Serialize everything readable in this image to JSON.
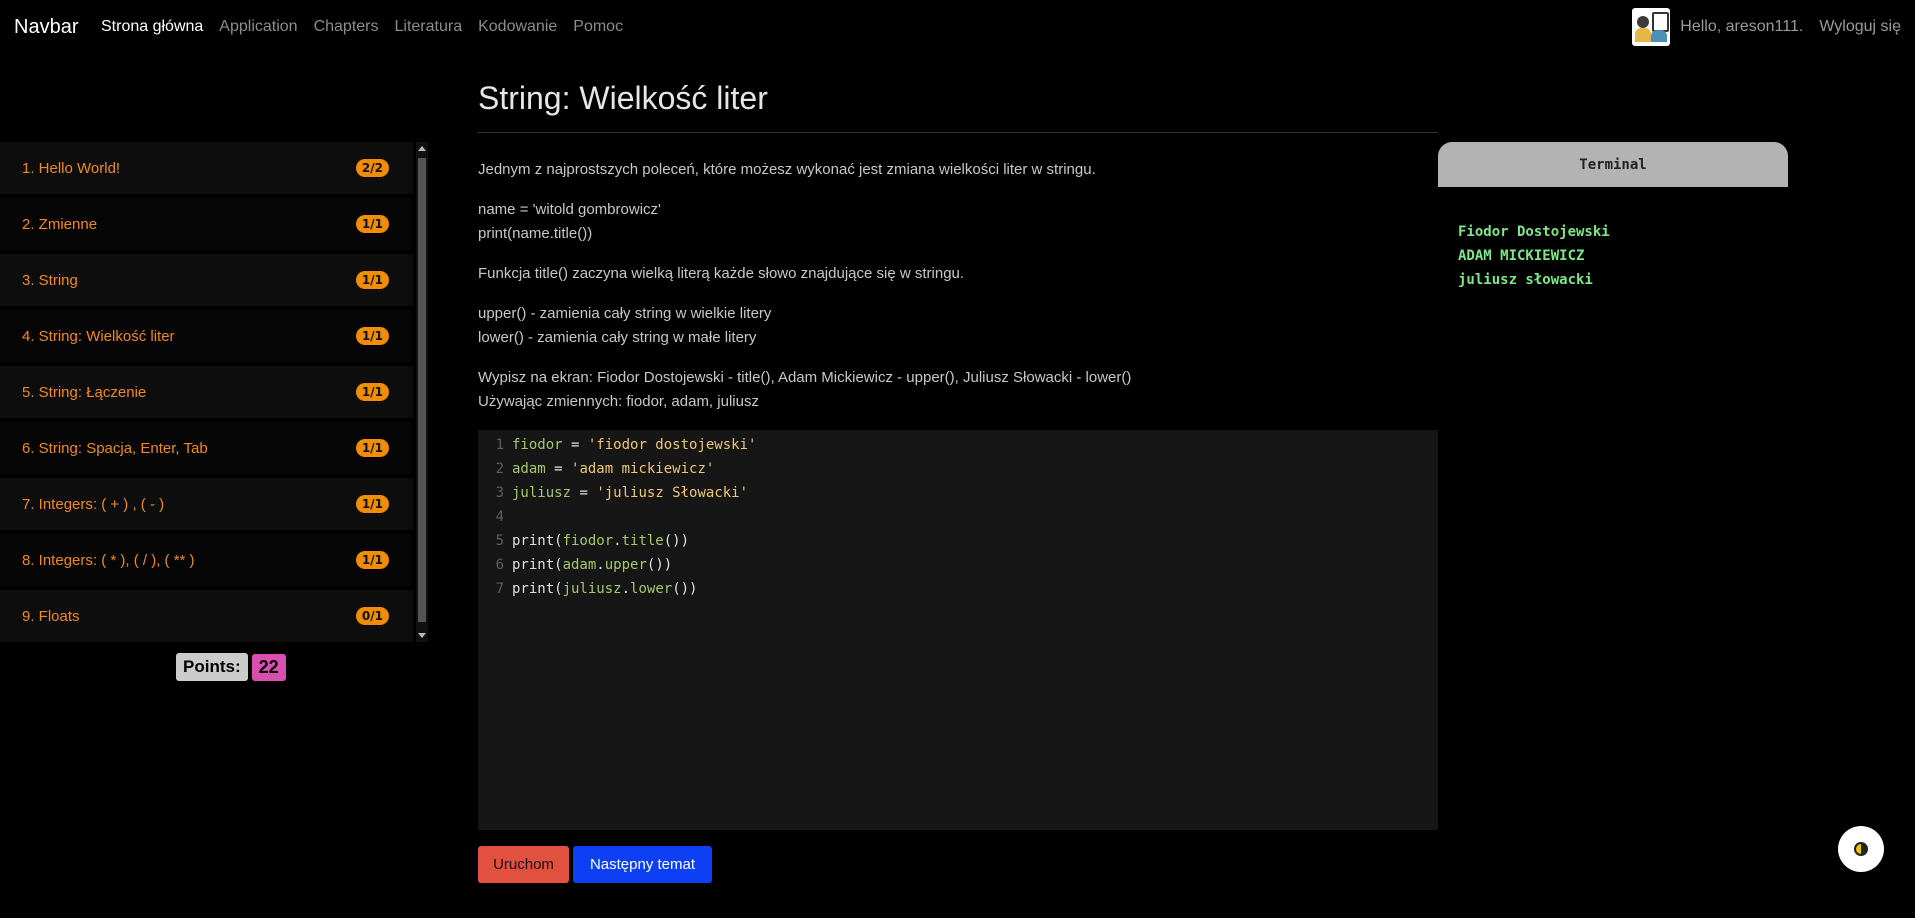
{
  "navbar": {
    "brand": "Navbar",
    "links": [
      {
        "label": "Strona główna",
        "active": true
      },
      {
        "label": "Application",
        "active": false
      },
      {
        "label": "Chapters",
        "active": false
      },
      {
        "label": "Literatura",
        "active": false
      },
      {
        "label": "Kodowanie",
        "active": false
      },
      {
        "label": "Pomoc",
        "active": false
      }
    ],
    "greeting": "Hello, areson111.",
    "logout": "Wyloguj się"
  },
  "sidebar": {
    "chapters": [
      {
        "label": "1. Hello World!",
        "progress": "2/2"
      },
      {
        "label": "2. Zmienne",
        "progress": "1/1"
      },
      {
        "label": "3. String",
        "progress": "1/1"
      },
      {
        "label": "4. String: Wielkość liter",
        "progress": "1/1"
      },
      {
        "label": "5. String: Łączenie",
        "progress": "1/1"
      },
      {
        "label": "6. String: Spacja, Enter, Tab",
        "progress": "1/1"
      },
      {
        "label": "7. Integers: ( + ) , ( - )",
        "progress": "1/1"
      },
      {
        "label": "8. Integers: ( * ), ( / ), ( ** )",
        "progress": "1/1"
      },
      {
        "label": "9. Floats",
        "progress": "0/1"
      }
    ],
    "points_label": "Points:",
    "points_value": "22"
  },
  "lesson": {
    "title": "String: Wielkość liter",
    "paragraphs": [
      "Jednym z najprostszych poleceń, które możesz wykonać jest zmiana wielkości liter w stringu.",
      "name = 'witold gombrowicz'",
      "print(name.title())",
      "Funkcja title() zaczyna wielką literą każde słowo znajdujące się w stringu.",
      "upper() - zamienia cały string w wielkie litery",
      "lower() - zamienia cały string w małe litery",
      "Wypisz na ekran: Fiodor Dostojewski - title(), Adam Mickiewicz - upper(), Juliusz Słowacki - lower()",
      "Używając zmiennych: fiodor, adam, juliusz"
    ]
  },
  "editor": {
    "lines": [
      {
        "n": "1",
        "var": "fiodor",
        "op": " = ",
        "str": "'fiodor dostojewski'"
      },
      {
        "n": "2",
        "var": "adam",
        "op": " = ",
        "str": "'adam mickiewicz'"
      },
      {
        "n": "3",
        "var": "juliusz",
        "op": " = ",
        "str": "'juliusz Słowacki'"
      },
      {
        "n": "4"
      },
      {
        "n": "5",
        "fn": "print(",
        "obj": "fiodor",
        "dot": ".",
        "method": "title",
        "tail": "())"
      },
      {
        "n": "6",
        "fn": "print(",
        "obj": "adam",
        "dot": ".",
        "method": "upper",
        "tail": "())"
      },
      {
        "n": "7",
        "fn": "print(",
        "obj": "juliusz",
        "dot": ".",
        "method": "lower",
        "tail": "())"
      }
    ]
  },
  "buttons": {
    "run": "Uruchom",
    "next": "Następny temat"
  },
  "terminal": {
    "title": "Terminal",
    "output": [
      "Fiodor Dostojewski",
      "ADAM MICKIEWICZ",
      "juliusz słowacki"
    ]
  },
  "theme_toggle": {
    "icon": "theme-toggle-icon"
  }
}
